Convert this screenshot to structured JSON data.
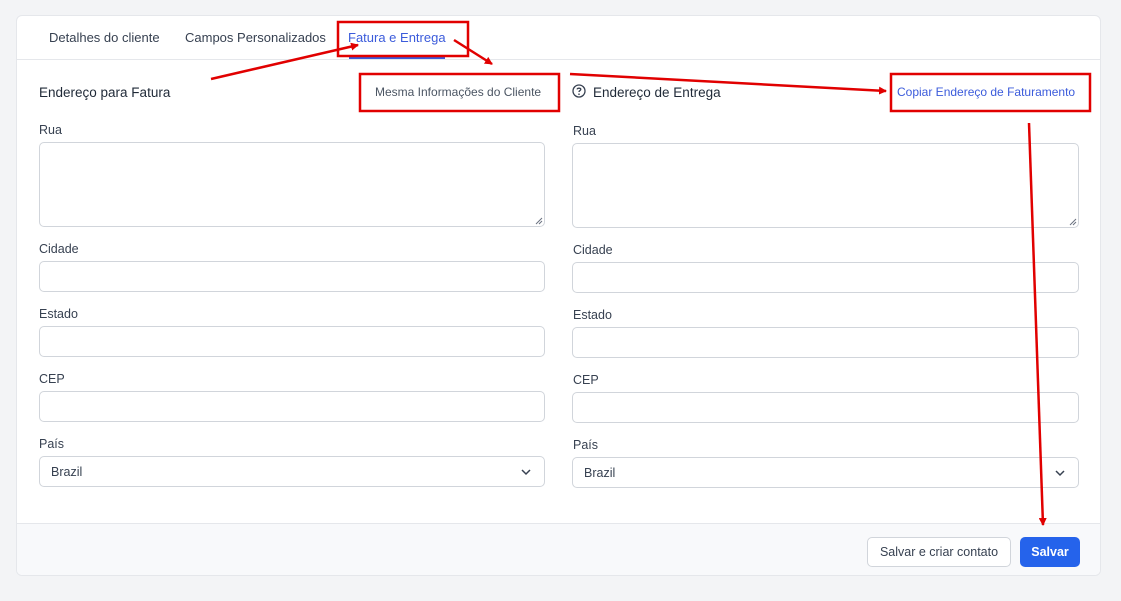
{
  "tabs": [
    {
      "label": "Detalhes do cliente"
    },
    {
      "label": "Campos Personalizados"
    },
    {
      "label": "Fatura e Entrega"
    }
  ],
  "billing": {
    "heading": "Endereço para Fatura",
    "same_info_label": "Mesma Informações do Cliente",
    "street_label": "Rua",
    "city_label": "Cidade",
    "state_label": "Estado",
    "zip_label": "CEP",
    "country_label": "País",
    "country_value": "Brazil"
  },
  "shipping": {
    "heading": "Endereço de Entrega",
    "copy_label": "Copiar Endereço de Faturamento",
    "street_label": "Rua",
    "city_label": "Cidade",
    "state_label": "Estado",
    "zip_label": "CEP",
    "country_label": "País",
    "country_value": "Brazil"
  },
  "footer": {
    "save_and_create_label": "Salvar e criar contato",
    "save_label": "Salvar"
  },
  "colors": {
    "accent": "#2563eb",
    "active_tab": "#3b5bdb",
    "annotation": "#e10000"
  }
}
